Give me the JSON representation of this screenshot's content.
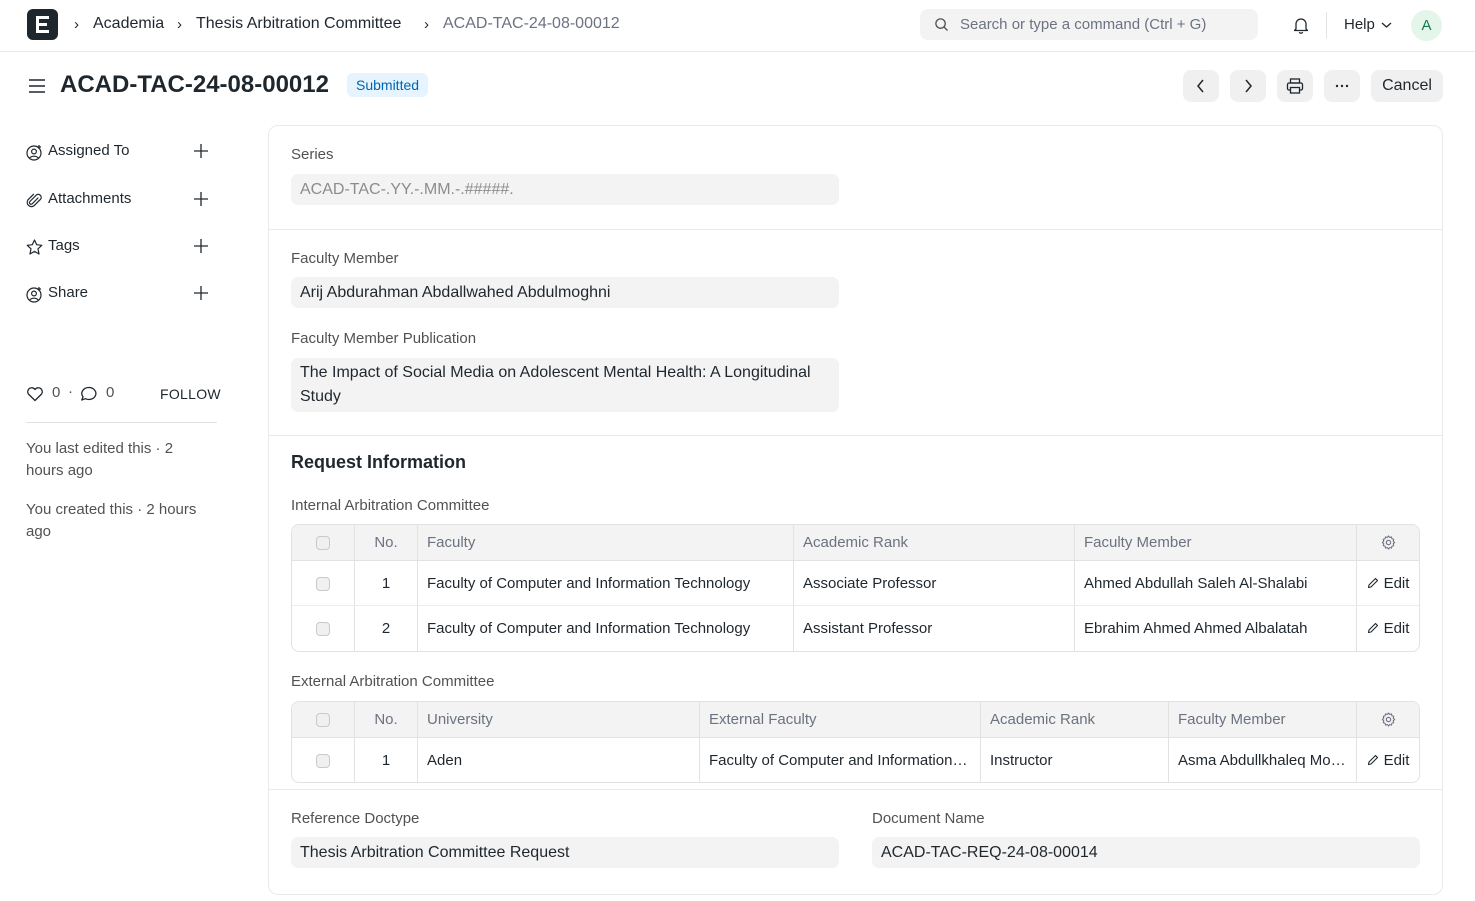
{
  "navbar": {
    "breadcrumbs": [
      "Academia",
      "Thesis Arbitration Committee",
      "ACAD-TAC-24-08-00012"
    ],
    "search_placeholder": "Search or type a command (Ctrl + G)",
    "help_label": "Help",
    "avatar_initial": "A"
  },
  "page": {
    "title": "ACAD-TAC-24-08-00012",
    "status": "Submitted",
    "cancel_label": "Cancel",
    "more_label": "···"
  },
  "sidebar": {
    "items": [
      {
        "label": "Assigned To",
        "icon": "user-plus-icon"
      },
      {
        "label": "Attachments",
        "icon": "paperclip-icon"
      },
      {
        "label": "Tags",
        "icon": "tag-icon"
      },
      {
        "label": "Share",
        "icon": "share-user-icon"
      }
    ],
    "likes": "0",
    "comments": "0",
    "dot": "·",
    "follow_label": "FOLLOW",
    "activity": [
      "You last edited this · 2 hours ago",
      "You created this · 2 hours ago"
    ]
  },
  "form": {
    "series": {
      "label": "Series",
      "value": "ACAD-TAC-.YY.-.MM.-.#####."
    },
    "faculty_member": {
      "label": "Faculty Member",
      "value": "Arij Abdurahman Abdallwahed Abdulmoghni"
    },
    "publication": {
      "label": "Faculty Member Publication",
      "value": "The Impact of Social Media on Adolescent Mental Health: A Longitudinal Study"
    },
    "request_section_title": "Request Information",
    "internal": {
      "label": "Internal Arbitration Committee",
      "headers": [
        "No.",
        "Faculty",
        "Academic Rank",
        "Faculty Member"
      ],
      "rows": [
        {
          "no": "1",
          "faculty": "Faculty of Computer and Information Technology",
          "rank": "Associate Professor",
          "member": "Ahmed Abdullah Saleh Al-Shalabi",
          "edit": "Edit"
        },
        {
          "no": "2",
          "faculty": "Faculty of Computer and Information Technology",
          "rank": "Assistant Professor",
          "member": "Ebrahim Ahmed Ahmed Albalatah",
          "edit": "Edit"
        }
      ]
    },
    "external": {
      "label": "External Arbitration Committee",
      "headers": [
        "No.",
        "University",
        "External Faculty",
        "Academic Rank",
        "Faculty Member"
      ],
      "rows": [
        {
          "no": "1",
          "university": "Aden",
          "faculty": "Faculty of Computer and Information Technology",
          "rank": "Instructor",
          "member": "Asma Abdullkhaleq Mohammed",
          "edit": "Edit"
        }
      ]
    },
    "reference_doctype": {
      "label": "Reference Doctype",
      "value": "Thesis Arbitration Committee Request"
    },
    "document_name": {
      "label": "Document Name",
      "value": "ACAD-TAC-REQ-24-08-00014"
    }
  },
  "colors": {
    "status_bg": "#e6f4ff",
    "status_text": "#0064b0",
    "avatar_bg": "#e4f5e9",
    "avatar_text": "#16794c"
  }
}
